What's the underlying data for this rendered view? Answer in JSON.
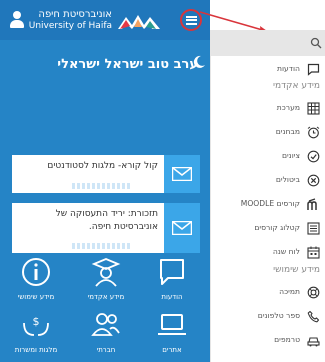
{
  "app": {
    "university_name_he": "אוניברסיטת חיפה",
    "university_name_en": "University of Haifa",
    "greeting": "ערב טוב ישראל ישראלי"
  },
  "colors": {
    "screen": "#2584c6",
    "header": "#2077bb",
    "accent": "#3ba6e8",
    "highlight": "#d9353b"
  },
  "cards": [
    {
      "text": "קול קורא- מלגות לסטודנטים",
      "icon": "mail-icon"
    },
    {
      "text": "תזכורת: יריד התעסוקה של אוניברסיטת חיפה.",
      "icon": "mail-icon"
    }
  ],
  "tiles": [
    {
      "label": "הודעות",
      "icon": "chat-bubble-icon"
    },
    {
      "label": "מידע אקדמי",
      "icon": "graduate-icon"
    },
    {
      "label": "מידע שימושי",
      "icon": "info-icon"
    },
    {
      "label": "אתרים",
      "icon": "laptop-icon"
    },
    {
      "label": "חברתי",
      "icon": "people-icon"
    },
    {
      "label": "מלגות ומשרות",
      "icon": "money-hands-icon"
    }
  ],
  "drawer": {
    "sections": [
      "מידע אקדמי",
      "מידע שימושי"
    ],
    "items": [
      {
        "label": "הודעות",
        "icon": "chat-icon"
      },
      {
        "label": "מערכת",
        "icon": "calendar-grid-icon"
      },
      {
        "label": "מבחנים",
        "icon": "alarm-clock-icon"
      },
      {
        "label": "ציונים",
        "icon": "check-circle-icon"
      },
      {
        "label": "ביטולים",
        "icon": "cancel-circle-icon"
      },
      {
        "label": "קורסים MOODLE",
        "icon": "moodle-icon"
      },
      {
        "label": "קטלוג קורסים",
        "icon": "list-icon"
      },
      {
        "label": "לוח שנה",
        "icon": "calendar-icon"
      },
      {
        "label": "תמיכה",
        "icon": "support-icon"
      },
      {
        "label": "ספר טלפונים",
        "icon": "phone-icon"
      },
      {
        "label": "טרמפים",
        "icon": "car-icon"
      }
    ]
  }
}
